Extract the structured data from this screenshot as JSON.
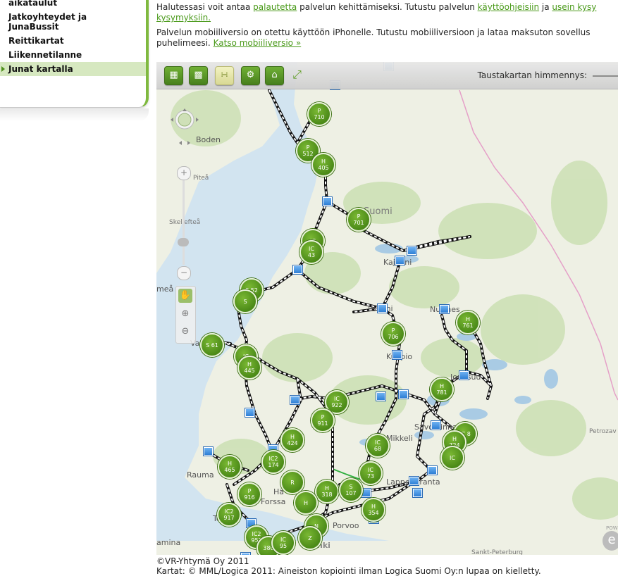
{
  "sidebar": {
    "items": [
      {
        "label": "aikataulut"
      },
      {
        "label": "Jatkoyhteydet ja\nJunaBussit"
      },
      {
        "label": "Reittikartat"
      },
      {
        "label": "Liikennetilanne"
      },
      {
        "label": "Junat kartalla",
        "active": true
      }
    ]
  },
  "intro": {
    "p1_a": "Halutessasi voit antaa ",
    "p1_link1": "palautetta",
    "p1_b": " palvelun kehittämiseksi. Tutustu palvelun ",
    "p1_link2": "käyttöohjeisiin",
    "p1_c": " ja ",
    "p1_link3": "usein kysy",
    "p1_link3b": "kysymyksiin.",
    "p2": "Palvelun mobiiliversio on otettu käyttöön iPhonelle. Tutustu mobiiliversioon ja lataa maksuton sovellus",
    "p2b": "puhelimeesi. ",
    "p2_link": "Katso mobiiliversio »"
  },
  "toolbar": {
    "buttons": [
      {
        "icon": "train-icon"
      },
      {
        "icon": "station-icon"
      },
      {
        "icon": "rss-icon"
      },
      {
        "icon": "gear-icon"
      },
      {
        "icon": "home-icon"
      },
      {
        "icon": "resize-icon"
      }
    ],
    "dim_label": "Taustakartan himmennys:"
  },
  "map": {
    "country_label": "Suomi",
    "cities": [
      {
        "name": "Boden"
      },
      {
        "name": "Piteå"
      },
      {
        "name": "Skellefteå"
      },
      {
        "name": "meå"
      },
      {
        "name": "Va"
      },
      {
        "name": "Rauma"
      },
      {
        "name": "Forssa"
      },
      {
        "name": "Porvoo"
      },
      {
        "name": "Lappeenranta"
      },
      {
        "name": "Petrozav"
      },
      {
        "name": "Sankt-Peterburg"
      },
      {
        "name": "amina"
      },
      {
        "name": "Kajaani"
      },
      {
        "name": "Nurmes"
      },
      {
        "name": "Iisalmi"
      },
      {
        "name": "Kuopio"
      },
      {
        "name": "Savonlinna"
      },
      {
        "name": "Joensuu"
      },
      {
        "name": "To"
      },
      {
        "name": "Hä"
      },
      {
        "name": "nki"
      },
      {
        "name": "Mikkeli"
      }
    ],
    "trains": [
      {
        "l1": "P",
        "l2": "710"
      },
      {
        "l1": "P",
        "l2": "512"
      },
      {
        "l1": "H",
        "l2": "405"
      },
      {
        "l1": "P",
        "l2": "701"
      },
      {
        "l1": "IC",
        "l2": ""
      },
      {
        "l1": "IC",
        "l2": "43"
      },
      {
        "l1": "S 52",
        "l2": ""
      },
      {
        "l1": "S",
        "l2": ""
      },
      {
        "l1": "P",
        "l2": "706"
      },
      {
        "l1": "H",
        "l2": "761"
      },
      {
        "l1": "S 61",
        "l2": ""
      },
      {
        "l1": "IC",
        "l2": ""
      },
      {
        "l1": "H",
        "l2": "445"
      },
      {
        "l1": "H",
        "l2": "781"
      },
      {
        "l1": "IC",
        "l2": "922"
      },
      {
        "l1": "P",
        "l2": "911"
      },
      {
        "l1": "IC 8",
        "l2": ""
      },
      {
        "l1": "H",
        "l2": "424"
      },
      {
        "l1": "IC",
        "l2": "68"
      },
      {
        "l1": "H",
        "l2": "724"
      },
      {
        "l1": "IC2",
        "l2": "174"
      },
      {
        "l1": "H",
        "l2": "465"
      },
      {
        "l1": "IC",
        "l2": "73"
      },
      {
        "l1": "IC",
        "l2": ""
      },
      {
        "l1": "R",
        "l2": ""
      },
      {
        "l1": "P",
        "l2": "916"
      },
      {
        "l1": "H",
        "l2": "318"
      },
      {
        "l1": "S",
        "l2": "107"
      },
      {
        "l1": "H",
        "l2": ""
      },
      {
        "l1": "H",
        "l2": "354"
      },
      {
        "l1": "IC2",
        "l2": "917"
      },
      {
        "l1": "N",
        "l2": ""
      },
      {
        "l1": "IC2",
        "l2": "951"
      },
      {
        "l1": "Z",
        "l2": ""
      },
      {
        "l1": "",
        "l2": "386"
      },
      {
        "l1": "IC",
        "l2": "95"
      }
    ]
  },
  "footer": {
    "copyright": "©VR-Yhtymä Oy 2011",
    "credits": "Kartat: © MML/Logica 2011: Aineiston kopiointi ilman Logica Suomi Oy:n lupaa on kielletty.",
    "powered_label": "POWE"
  }
}
